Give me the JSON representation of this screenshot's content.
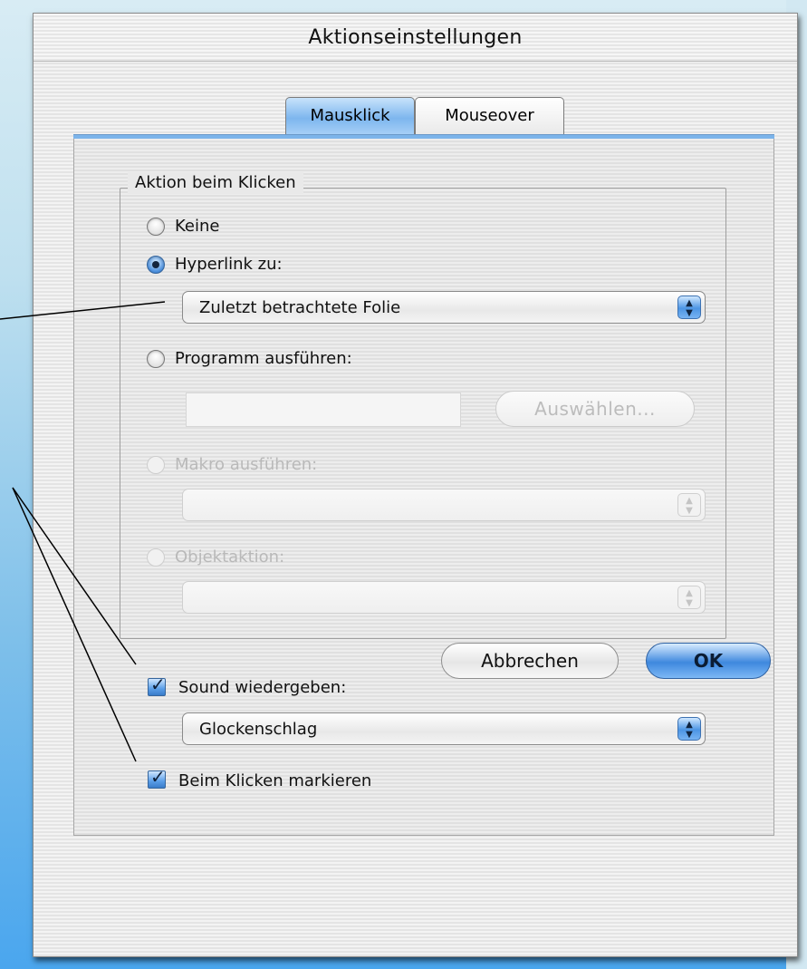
{
  "window": {
    "title": "Aktionseinstellungen"
  },
  "tabs": [
    {
      "label": "Mausklick",
      "selected": true
    },
    {
      "label": "Mouseover",
      "selected": false
    }
  ],
  "group": {
    "legend": "Aktion beim Klicken",
    "options": [
      {
        "label": "Keine",
        "selected": false,
        "enabled": true
      },
      {
        "label": "Hyperlink zu:",
        "selected": true,
        "enabled": true
      },
      {
        "label": "Programm ausführen:",
        "selected": false,
        "enabled": true
      },
      {
        "label": "Makro ausführen:",
        "selected": false,
        "enabled": false
      },
      {
        "label": "Objektaktion:",
        "selected": false,
        "enabled": false
      }
    ],
    "hyperlink_popup": {
      "value": "Zuletzt betrachtete Folie"
    },
    "program_field": {
      "value": ""
    },
    "choose_button": {
      "label": "Auswählen...",
      "enabled": false
    },
    "macro_popup": {
      "value": "",
      "enabled": false
    },
    "object_action_popup": {
      "value": "",
      "enabled": false
    }
  },
  "sound": {
    "checkbox_label": "Sound wiedergeben:",
    "checked": true,
    "popup_value": "Glockenschlag"
  },
  "highlight": {
    "checkbox_label": "Beim Klicken markieren",
    "checked": true
  },
  "buttons": {
    "cancel": "Abbrechen",
    "ok": "OK"
  },
  "colors": {
    "accent": "#4b8fdd",
    "tab_selected": "#7db6ee",
    "disabled_text": "#b9b9b9"
  }
}
